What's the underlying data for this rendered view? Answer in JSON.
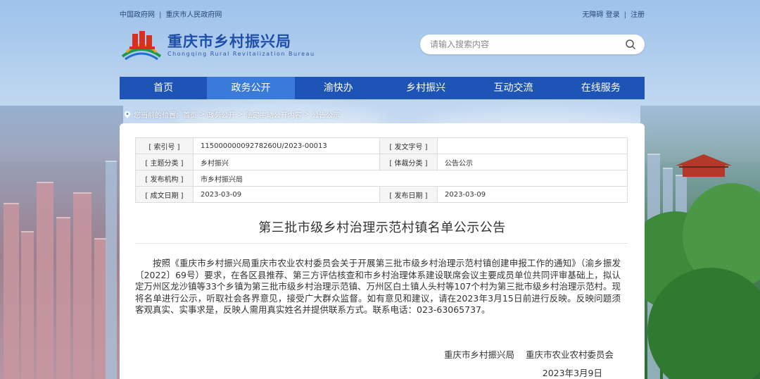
{
  "topbar": {
    "links_left": [
      "中国政府网",
      "重庆市人民政府网"
    ],
    "links_right": [
      "无障碍",
      "登录",
      "注册"
    ],
    "separator": "|"
  },
  "header": {
    "title": "重庆市乡村振兴局",
    "subtitle": "Chongqing Rural Revitalization Bureau",
    "logo_icon": "bureau-logo-icon"
  },
  "search": {
    "placeholder": "请输入搜索内容",
    "icon": "search-icon"
  },
  "nav": {
    "items": [
      "首页",
      "政务公开",
      "渝快办",
      "乡村振兴",
      "互动交流",
      "在线服务"
    ],
    "active_index": 1,
    "color": "#1d54b5",
    "active_color": "#3a7ad8"
  },
  "breadcrumb": {
    "prefix": "您当前的位置：",
    "items": [
      "首页",
      "政务公开",
      "法定主动公开内容",
      "公告公示"
    ],
    "arrow": ">"
  },
  "meta": {
    "rows": [
      {
        "k1": "[ 索引号 ]",
        "v1": "11500000009278260U/2023-00013",
        "k2": "[ 发文字号 ]",
        "v2": ""
      },
      {
        "k1": "[ 主题分类 ]",
        "v1": "乡村振兴",
        "k2": "[ 体裁分类 ]",
        "v2": "公告公示"
      },
      {
        "k1": "[ 发布机构 ]",
        "v1": "市乡村振兴局"
      },
      {
        "k1": "[ 成文日期 ]",
        "v1": "2023-03-09",
        "k2": "[ 发布日期 ]",
        "v2": "2023-03-09"
      }
    ]
  },
  "document": {
    "title": "第三批市级乡村治理示范村镇名单公示公告",
    "body": "按照《重庆市乡村振兴局重庆市农业农村委员会关于开展第三批市级乡村治理示范村镇创建申报工作的通知》（渝乡振发〔2022〕69号）要求，在各区县推荐、第三方评估核查和市乡村治理体系建设联席会议主要成员单位共同评审基础上，拟认定万州区龙沙镇等33个乡镇为第三批市级乡村治理示范镇、万州区白土镇人头村等107个村为第三批市级乡村治理示范村。现将名单进行公示，听取社会各界意见，接受广大群众监督。如有意见和建议，请在2023年3月15日前进行反映。反映问题须客观真实、实事求是，反映人需用真实姓名并提供联系方式。联系电话：023-63065737。",
    "signers": [
      "重庆市乡村振兴局",
      "重庆市农业农村委员会"
    ],
    "date": "2023年3月9日"
  }
}
